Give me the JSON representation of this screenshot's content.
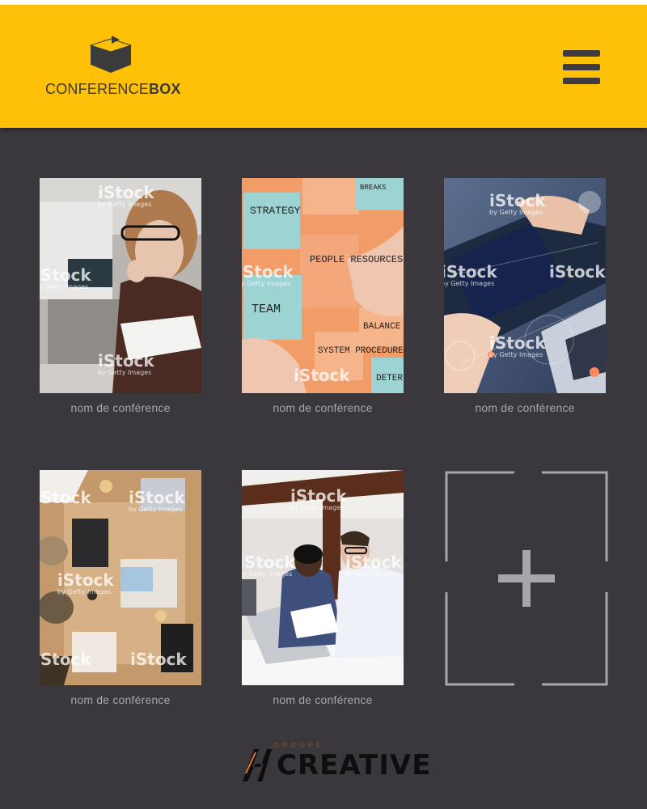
{
  "header": {
    "brand_light": "CONFERENCE",
    "brand_bold": "BOX",
    "background": "#fec107",
    "menu_icon": "hamburger-menu-icon"
  },
  "conferences": [
    {
      "caption": "nom de conférence",
      "watermark": "iStock",
      "watermark_sub": "by Getty Images"
    },
    {
      "caption": "nom de conférence",
      "watermark": "iStock",
      "watermark_sub": "by Getty Images",
      "sticky_notes": [
        "STRATEGY",
        "PEOPLE RESOURCES",
        "TEAM",
        "SYSTEM PROCEDURE",
        "BALANCE",
        "DETER",
        "BREAKS"
      ]
    },
    {
      "caption": "nom de conférence",
      "watermark": "iStock",
      "watermark_sub": "by Getty Images"
    },
    {
      "caption": "nom de conférence",
      "watermark": "iStock",
      "watermark_sub": "by Getty Images"
    },
    {
      "caption": "nom de conférence",
      "watermark": "iStock",
      "watermark_sub": "by Getty Images"
    }
  ],
  "add_tile": {
    "icon": "plus-icon"
  },
  "footer": {
    "sub": "GROUPE",
    "word": "CREATIVE"
  },
  "colors": {
    "page_background": "#3a383d",
    "caption": "#a8a6aa",
    "add_tile_stroke": "#a7a6aa"
  }
}
